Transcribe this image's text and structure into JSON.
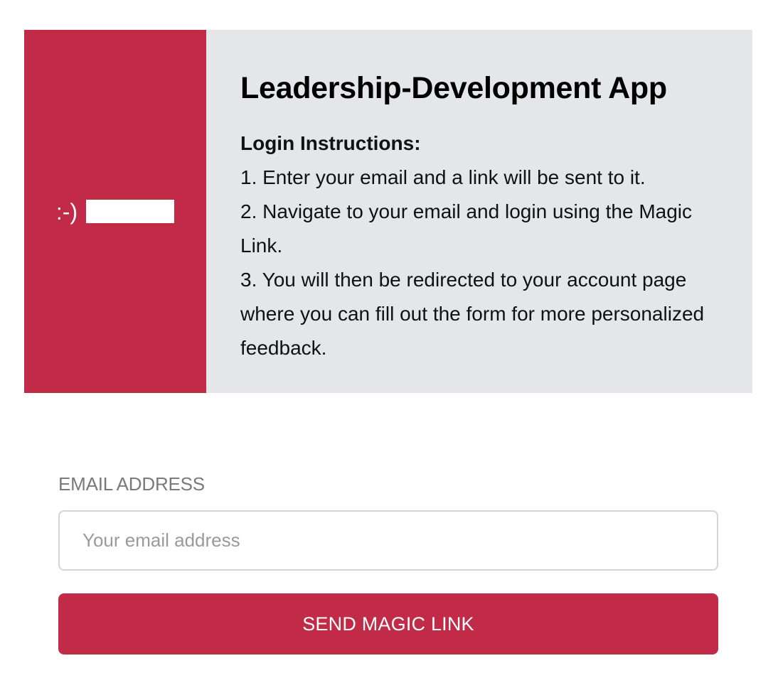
{
  "brand": {
    "smiley_text": ":-)",
    "logo_icon": "white-rectangle-logo",
    "accent_color": "#c22b47"
  },
  "info": {
    "title": "Leadership-Development App",
    "instructions_heading": "Login Instructions:",
    "instructions": [
      "1. Enter your email and a link will be sent to it.",
      "2. Navigate to your email and login using the Magic Link.",
      "3. You will then be redirected to your account page where you can fill out the form for more personalized feedback."
    ],
    "background_color": "#e5e6ea"
  },
  "form": {
    "email_label": "EMAIL ADDRESS",
    "email_value": "",
    "email_placeholder": "Your email address",
    "submit_label": "SEND MAGIC LINK"
  }
}
